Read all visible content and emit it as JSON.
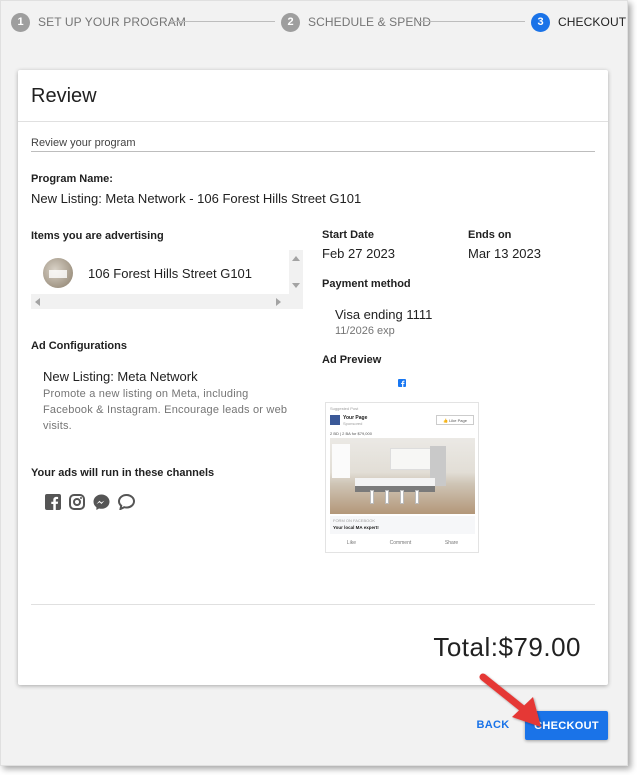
{
  "stepper": {
    "steps": [
      {
        "number": "1",
        "label": "SET UP YOUR PROGRAM"
      },
      {
        "number": "2",
        "label": "SCHEDULE & SPEND"
      },
      {
        "number": "3",
        "label": "CHECKOUT"
      }
    ],
    "active_step": 3
  },
  "card": {
    "title": "Review",
    "subtitle": "Review your program"
  },
  "program": {
    "name_label": "Program Name:",
    "name_value": "New Listing: Meta Network - 106 Forest Hills Street G101"
  },
  "items": {
    "label": "Items you are advertising",
    "list": [
      "106 Forest Hills Street G101"
    ]
  },
  "schedule": {
    "start_label": "Start Date",
    "start_value": "Feb 27 2023",
    "end_label": "Ends on",
    "end_value": "Mar 13 2023"
  },
  "payment": {
    "label": "Payment method",
    "card": "Visa ending 1111",
    "exp": "11/2026 exp"
  },
  "ad_config": {
    "label": "Ad Configurations",
    "title": "New Listing: Meta Network",
    "description": "Promote a new listing on Meta, including Facebook & Instagram. Encourage leads or web visits."
  },
  "channels": {
    "label": "Your ads will run in these channels",
    "icons": [
      "facebook-icon",
      "instagram-icon",
      "messenger-icon",
      "chat-icon"
    ]
  },
  "ad_preview": {
    "label": "Ad Preview",
    "top_text": "Suggested Post",
    "page_name": "Your Page",
    "sponsored": "Sponsored",
    "like_page": "Like Page",
    "caption": "2 BD | 2 BA for $79,000",
    "form_label": "FORM ON FACEBOOK",
    "form_title": "Your local MA expert!",
    "actions": [
      "Like",
      "Comment",
      "Share"
    ]
  },
  "total": {
    "label": "Total:",
    "value": "$79.00"
  },
  "buttons": {
    "back": "BACK",
    "checkout": "CHECKOUT"
  },
  "colors": {
    "primary": "#1a73e8",
    "annotation_arrow": "#e53935"
  }
}
